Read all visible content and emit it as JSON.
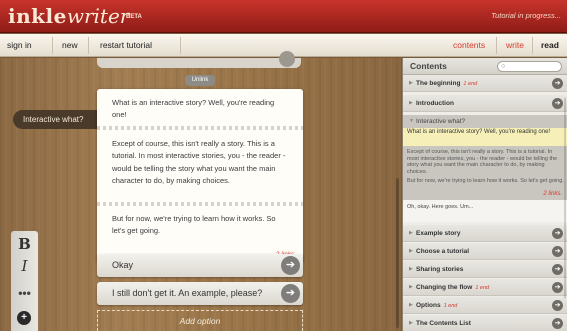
{
  "app": {
    "logo_main": "inkle",
    "logo_sub": "writer",
    "logo_badge": "BETA",
    "status": "Tutorial in progress..."
  },
  "toolbar": {
    "sign_in": "sign in",
    "new": "new",
    "restart": "restart tutorial",
    "contents": "contents",
    "write": "write",
    "read": "read"
  },
  "editor": {
    "section_label": "Interactive what?",
    "unlink_label": "Unlink",
    "paragraphs": [
      "What is an interactive story? Well, you're reading one!",
      "Except of course, this isn't really a story. This is a tutorial. In most interactive stories, you - the reader - would be telling the story what you want the main character to do, by making choices.",
      "But for now, we're trying to learn how it works. So let's get going."
    ],
    "links_note": "2 links.",
    "options": [
      {
        "label": "Okay"
      },
      {
        "label": "I still don't get it. An example, please?"
      }
    ],
    "add_option": "Add option",
    "format": {
      "bold": "B",
      "italic": "I",
      "more": "•••",
      "add": "+"
    }
  },
  "contents": {
    "title": "Contents",
    "search_placeholder": "",
    "items_top": [
      {
        "label": "The beginning",
        "end": "1 end"
      },
      {
        "label": "Introduction",
        "end": ""
      }
    ],
    "expanded": {
      "label": "Interactive what?",
      "highlight": "What is an interactive story? Well, you're reading one!",
      "text1": "Except of course, this isn't really a story. This is a tutorial. In most interactive stories, you - the reader - would be telling the story what you want the main character to do, by making choices.",
      "text2": "But for now, we're trying to learn how it works. So let's get going.",
      "links": "2 links.",
      "next": "Oh, okay. Here goes. Um..."
    },
    "items_bottom": [
      {
        "label": "Example story",
        "end": ""
      },
      {
        "label": "Choose a tutorial",
        "end": ""
      },
      {
        "label": "Sharing stories",
        "end": ""
      },
      {
        "label": "Changing the flow",
        "end": "1 end"
      },
      {
        "label": "Options",
        "end": "1 end"
      },
      {
        "label": "The Contents List",
        "end": ""
      }
    ]
  },
  "colors": {
    "header_red": "#b02a22",
    "accent_red": "#d63a2e",
    "wood": "#9a7549"
  }
}
